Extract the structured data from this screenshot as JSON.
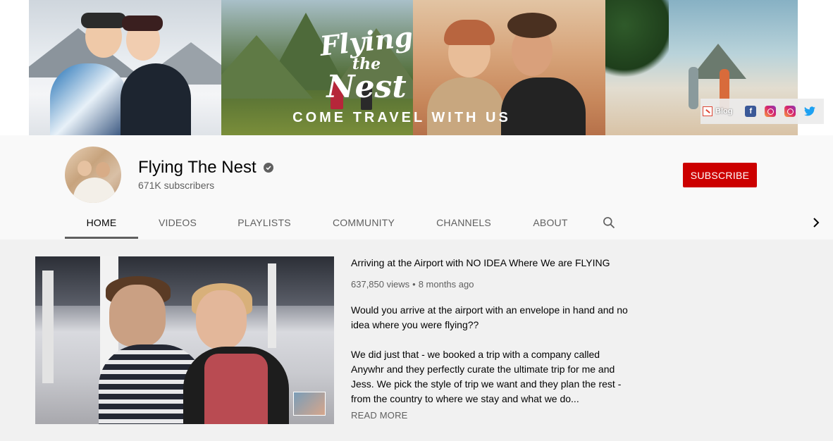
{
  "banner": {
    "script_line1": "Flying",
    "script_line2": "the",
    "script_line3": "Nest",
    "tagline": "COME TRAVEL WITH US",
    "links": {
      "blog_label": "Blog",
      "social": [
        "facebook-icon",
        "instagram-icon",
        "instagram-icon",
        "twitter-icon"
      ]
    }
  },
  "channel": {
    "name": "Flying The Nest",
    "subscribers": "671K subscribers",
    "subscribe_label": "SUBSCRIBE"
  },
  "tabs": [
    {
      "label": "HOME",
      "active": true
    },
    {
      "label": "VIDEOS",
      "active": false
    },
    {
      "label": "PLAYLISTS",
      "active": false
    },
    {
      "label": "COMMUNITY",
      "active": false
    },
    {
      "label": "CHANNELS",
      "active": false
    },
    {
      "label": "ABOUT",
      "active": false
    }
  ],
  "featured_video": {
    "title": "Arriving at the Airport with NO IDEA Where We are FLYING",
    "views": "637,850 views",
    "separator": "•",
    "age": "8 months ago",
    "description_p1": "Would you arrive at the airport with an envelope in hand and no idea where you were flying??",
    "description_p2": "We did just that - we booked a trip with a company called Anywhr and they perfectly curate the ultimate trip for me and Jess. We pick the style of trip we want and they plan the rest - from the country to where we stay and what we do...",
    "read_more": "READ MORE"
  },
  "colors": {
    "subscribe_red": "#cc0000",
    "page_bg": "#f1f1f1",
    "header_bg": "#f9f9f9",
    "secondary_text": "#606060"
  }
}
